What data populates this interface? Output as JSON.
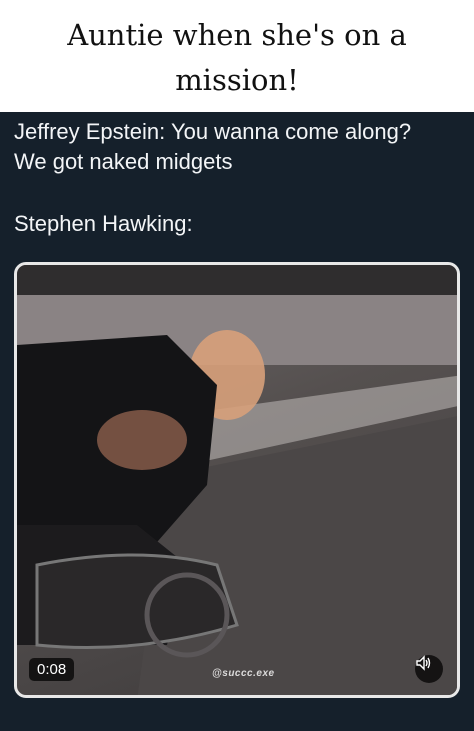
{
  "caption": {
    "line1": "Auntie when she's on a",
    "line2": "mission!"
  },
  "tweet": {
    "lines": [
      "Jeffrey Epstein:  You wanna come along?",
      "We got naked midgets",
      "Stephen Hawking:"
    ]
  },
  "video": {
    "time": "0:08",
    "watermark": "@succc.exe",
    "sound_icon": "speaker-icon"
  },
  "colors": {
    "tweet_bg": "#15202b",
    "text": "#f3f5f7",
    "caption_bg": "#ffffff"
  }
}
